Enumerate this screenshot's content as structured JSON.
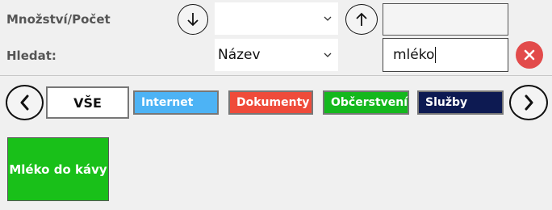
{
  "filters": {
    "quantity_label": "Množství/Počet",
    "search_label": "Hledat:",
    "field_select_value": "Název",
    "search_value": "mléko"
  },
  "categories": {
    "all_label": "VŠE",
    "items": [
      {
        "label": "Internet",
        "color": "#4db3f5",
        "text_color": "#ffffff"
      },
      {
        "label": "Dokumenty",
        "color": "#ef4b3a",
        "text_color": "#ffffff"
      },
      {
        "label": "Občerstvení",
        "color": "#14b81d",
        "text_color": "#ffffff"
      },
      {
        "label": "Služby",
        "color": "#0d1a52",
        "text_color": "#ffffff"
      }
    ]
  },
  "products": [
    {
      "label": "Mléko do kávy",
      "color": "#19c019"
    }
  ],
  "icons": {
    "sort_desc": "arrow-down-icon",
    "sort_asc": "arrow-up-icon",
    "clear": "close-icon",
    "prev": "chevron-left-icon",
    "next": "chevron-right-icon"
  }
}
